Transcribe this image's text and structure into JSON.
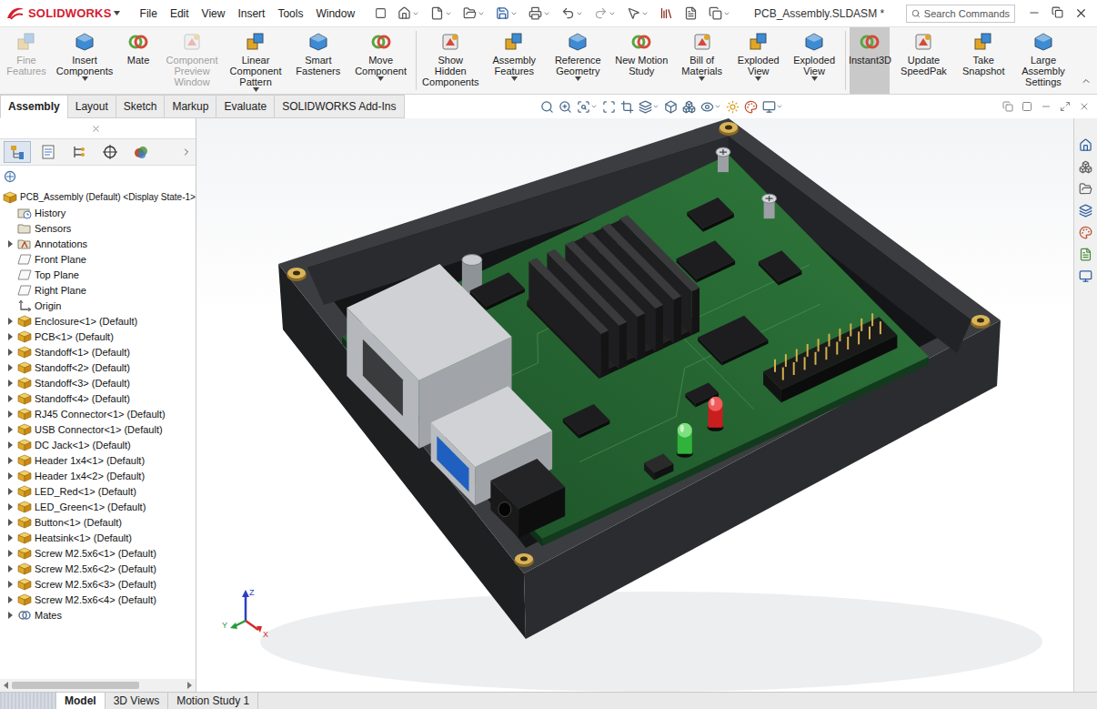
{
  "app": {
    "logo": "SOLIDWORKS"
  },
  "menu": [
    {
      "label": "File"
    },
    {
      "label": "Edit"
    },
    {
      "label": "View"
    },
    {
      "label": "Insert"
    },
    {
      "label": "Tools"
    },
    {
      "label": "Window"
    }
  ],
  "window": {
    "title": "PCB_Assembly.SLDASM *"
  },
  "search": {
    "placeholder": "Search Commands"
  },
  "ribbon": [
    {
      "label": "Fine Features",
      "disabled": true,
      "selected": false,
      "dropdown": false
    },
    {
      "label": "Insert Components",
      "disabled": false,
      "selected": false,
      "dropdown": true
    },
    {
      "label": "Mate",
      "disabled": false,
      "selected": false,
      "dropdown": false
    },
    {
      "label": "Component Preview Window",
      "disabled": true,
      "selected": false,
      "dropdown": false
    },
    {
      "label": "Linear Component Pattern",
      "disabled": false,
      "selected": false,
      "dropdown": true
    },
    {
      "label": "Smart Fasteners",
      "disabled": false,
      "selected": false,
      "dropdown": false
    },
    {
      "label": "Move Component",
      "disabled": false,
      "selected": false,
      "dropdown": true
    },
    {
      "label": "Show Hidden Components",
      "disabled": false,
      "selected": false,
      "dropdown": false
    },
    {
      "label": "Assembly Features",
      "disabled": false,
      "selected": false,
      "dropdown": true
    },
    {
      "label": "Reference Geometry",
      "disabled": false,
      "selected": false,
      "dropdown": true
    },
    {
      "label": "New Motion Study",
      "disabled": false,
      "selected": false,
      "dropdown": false
    },
    {
      "label": "Bill of Materials",
      "disabled": false,
      "selected": false,
      "dropdown": true
    },
    {
      "label": "Exploded View",
      "disabled": false,
      "selected": false,
      "dropdown": true
    },
    {
      "label": "Exploded View",
      "disabled": false,
      "selected": false,
      "dropdown": true
    },
    {
      "label": "Instant3D",
      "disabled": false,
      "selected": true,
      "dropdown": false
    },
    {
      "label": "Update SpeedPak",
      "disabled": false,
      "selected": false,
      "dropdown": false
    },
    {
      "label": "Take Snapshot",
      "disabled": false,
      "selected": false,
      "dropdown": false
    },
    {
      "label": "Large Assembly Settings",
      "disabled": false,
      "selected": false,
      "dropdown": false
    }
  ],
  "tabs": [
    {
      "label": "Assembly",
      "selected": true
    },
    {
      "label": "Layout",
      "selected": false
    },
    {
      "label": "Sketch",
      "selected": false
    },
    {
      "label": "Markup",
      "selected": false
    },
    {
      "label": "Evaluate",
      "selected": false
    },
    {
      "label": "SOLIDWORKS Add-Ins",
      "selected": false
    }
  ],
  "panel_tabs": [
    {
      "selected": true
    },
    {
      "selected": false
    },
    {
      "selected": false
    },
    {
      "selected": false
    },
    {
      "selected": false
    }
  ],
  "tree": {
    "root": "PCB_Assembly (Default) <Display State-1>",
    "items": [
      {
        "label": "History",
        "kind": "history",
        "expandable": false,
        "expanded": false
      },
      {
        "label": "Sensors",
        "kind": "sensor",
        "expandable": false,
        "expanded": false
      },
      {
        "label": "Annotations",
        "kind": "annotation",
        "expandable": true,
        "expanded": false
      },
      {
        "label": "Front Plane",
        "kind": "plane",
        "expandable": false,
        "expanded": false
      },
      {
        "label": "Top Plane",
        "kind": "plane",
        "expandable": false,
        "expanded": false
      },
      {
        "label": "Right Plane",
        "kind": "plane",
        "expandable": false,
        "expanded": false
      },
      {
        "label": "Origin",
        "kind": "origin",
        "expandable": false,
        "expanded": false
      },
      {
        "label": "Enclosure<1> (Default)",
        "kind": "part",
        "expandable": true,
        "expanded": false
      },
      {
        "label": "PCB<1> (Default)",
        "kind": "part",
        "expandable": true,
        "expanded": false
      },
      {
        "label": "Standoff<1> (Default)",
        "kind": "part",
        "expandable": true,
        "expanded": false
      },
      {
        "label": "Standoff<2> (Default)",
        "kind": "part",
        "expandable": true,
        "expanded": false
      },
      {
        "label": "Standoff<3> (Default)",
        "kind": "part",
        "expandable": true,
        "expanded": false
      },
      {
        "label": "Standoff<4> (Default)",
        "kind": "part",
        "expandable": true,
        "expanded": false
      },
      {
        "label": "RJ45 Connector<1> (Default)",
        "kind": "part",
        "expandable": true,
        "expanded": false
      },
      {
        "label": "USB Connector<1> (Default)",
        "kind": "part",
        "expandable": true,
        "expanded": false
      },
      {
        "label": "DC Jack<1> (Default)",
        "kind": "part",
        "expandable": true,
        "expanded": false
      },
      {
        "label": "Header 1x4<1> (Default)",
        "kind": "part",
        "expandable": true,
        "expanded": false
      },
      {
        "label": "Header 1x4<2> (Default)",
        "kind": "part",
        "expandable": true,
        "expanded": false
      },
      {
        "label": "LED_Red<1> (Default)",
        "kind": "part",
        "expandable": true,
        "expanded": false
      },
      {
        "label": "LED_Green<1> (Default)",
        "kind": "part",
        "expandable": true,
        "expanded": false
      },
      {
        "label": "Button<1> (Default)",
        "kind": "part",
        "expandable": true,
        "expanded": false
      },
      {
        "label": "Heatsink<1> (Default)",
        "kind": "part",
        "expandable": true,
        "expanded": false
      },
      {
        "label": "Screw M2.5x6<1> (Default)",
        "kind": "part",
        "expandable": true,
        "expanded": false
      },
      {
        "label": "Screw M2.5x6<2> (Default)",
        "kind": "part",
        "expandable": true,
        "expanded": false
      },
      {
        "label": "Screw M2.5x6<3> (Default)",
        "kind": "part",
        "expandable": true,
        "expanded": false
      },
      {
        "label": "Screw M2.5x6<4> (Default)",
        "kind": "part",
        "expandable": true,
        "expanded": false
      },
      {
        "label": "Mates",
        "kind": "mates",
        "expandable": true,
        "expanded": false
      }
    ]
  },
  "triad": {
    "x": "X",
    "y": "Y",
    "z": "Z"
  },
  "bottom_tabs": [
    {
      "label": "Model",
      "selected": true
    },
    {
      "label": "3D Views",
      "selected": false
    },
    {
      "label": "Motion Study 1",
      "selected": false
    }
  ]
}
